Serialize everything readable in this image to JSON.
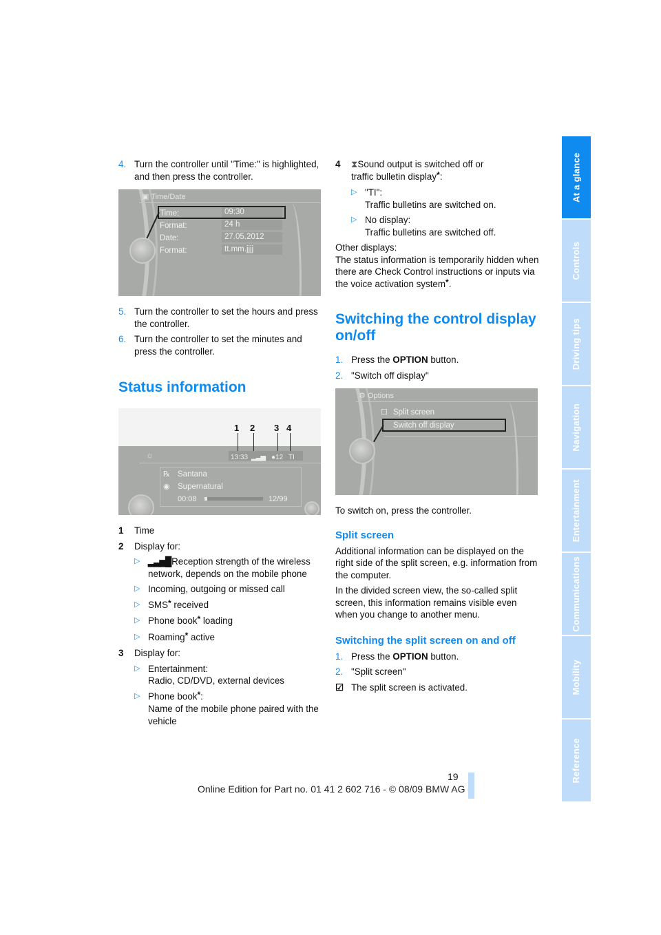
{
  "page": {
    "number": "19",
    "footer": "Online Edition for Part no. 01 41 2 602 716 - © 08/09 BMW AG"
  },
  "side_tabs": [
    {
      "label": "At a glance",
      "active": true
    },
    {
      "label": "Controls",
      "active": false
    },
    {
      "label": "Driving tips",
      "active": false
    },
    {
      "label": "Navigation",
      "active": false
    },
    {
      "label": "Entertainment",
      "active": false
    },
    {
      "label": "Communications",
      "active": false
    },
    {
      "label": "Mobility",
      "active": false
    },
    {
      "label": "Reference",
      "active": false
    }
  ],
  "left": {
    "step4": {
      "num": "4.",
      "text": "Turn the controller until \"Time:\" is highlighted, and then press the controller."
    },
    "screen_timedate": {
      "title": "Time/Date",
      "rows": [
        {
          "label": "Time:",
          "value": "09:30"
        },
        {
          "label": "Format:",
          "value": "24 h"
        },
        {
          "label": "Date:",
          "value": "27.05.2012"
        },
        {
          "label": "Format:",
          "value": "tt.mm.jjjj"
        }
      ]
    },
    "step5": {
      "num": "5.",
      "text": "Turn the controller to set the hours and press the controller."
    },
    "step6": {
      "num": "6.",
      "text": "Turn the controller to set the minutes and press the controller."
    },
    "heading_status": "Status information",
    "screen_status": {
      "callouts": [
        "1",
        "2",
        "3",
        "4"
      ],
      "time": "13:33",
      "station": "12",
      "ti": "TI",
      "artist": "Santana",
      "album": "Supernatural",
      "elapsed": "00:08",
      "track": "12/99",
      "progress": 0.05
    },
    "legend": {
      "item1": {
        "num": "1",
        "text": "Time"
      },
      "item2": {
        "num": "2",
        "text": "Display for:"
      },
      "item2_bullets": {
        "b1": "Reception strength of the wireless network, depends on the mobile phone",
        "b2": "Incoming, outgoing or missed call",
        "b3_pre": "SMS",
        "b3_post": " received",
        "b4_pre": "Phone book",
        "b4_post": " loading",
        "b5_pre": "Roaming",
        "b5_post": " active"
      },
      "item3": {
        "num": "3",
        "text": "Display for:"
      },
      "item3_bullets": {
        "b1_l1": "Entertainment:",
        "b1_l2": "Radio, CD/DVD, external devices",
        "b2_l1_pre": "Phone book",
        "b2_l1_post": ":",
        "b2_l2": "Name of the mobile phone paired with the vehicle"
      }
    }
  },
  "right": {
    "item4": {
      "num": "4",
      "text_l1": "Sound output is switched off or",
      "text_l2_pre": "traffic bulletin display",
      "text_l2_post": ":"
    },
    "item4_bullets": {
      "b1_l1": "\"TI\":",
      "b1_l2": "Traffic bulletins are switched on.",
      "b2_l1": "No display:",
      "b2_l2": "Traffic bulletins are switched off."
    },
    "other_displays_l1": "Other displays:",
    "other_displays_l2_pre": "The status information is temporarily hidden when there are Check Control instructions or inputs via the voice activation system",
    "other_displays_l2_post": ".",
    "heading_switch": "Switching the control display on/off",
    "step1": {
      "num": "1.",
      "pre": "Press the ",
      "bold": "OPTION",
      "post": " button."
    },
    "step2": {
      "num": "2.",
      "text": "\"Switch off display\""
    },
    "screen_options": {
      "title": "Options",
      "items": [
        "Split screen",
        "Switch off display"
      ]
    },
    "switch_on": "To switch on, press the controller.",
    "heading_split": "Split screen",
    "split_p1": "Additional information can be displayed on the right side of the split screen, e.g. information from the computer.",
    "split_p2": "In the divided screen view, the so-called split screen, this information remains visible even when you change to another menu.",
    "heading_split_onoff": "Switching the split screen on and off",
    "s_step1": {
      "num": "1.",
      "pre": "Press the ",
      "bold": "OPTION",
      "post": " button."
    },
    "s_step2": {
      "num": "2.",
      "text": "\"Split screen\""
    },
    "activated": "The split screen is activated."
  },
  "symbols": {
    "star": "*",
    "bullet": "▷"
  },
  "colors": {
    "accent": "#0f8bef",
    "tab_inactive": "#bfddfa"
  }
}
